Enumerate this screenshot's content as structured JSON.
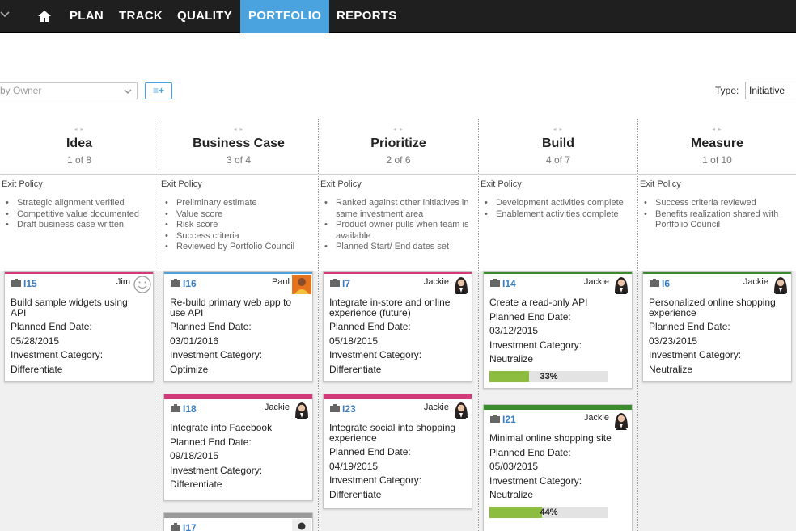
{
  "nav": {
    "items": [
      {
        "label": "PLAN"
      },
      {
        "label": "TRACK"
      },
      {
        "label": "QUALITY"
      },
      {
        "label": "PORTFOLIO",
        "active": true
      },
      {
        "label": "REPORTS"
      }
    ],
    "active_color": "#4aa3df"
  },
  "filters": {
    "owner_placeholder": "by Owner",
    "add_label": "≡+",
    "type_label": "Type:",
    "type_value": "Initiative"
  },
  "columns": [
    {
      "title": "Idea",
      "count": "1 of 8",
      "policy_title": "Exit Policy",
      "policy": [
        "Strategic alignment verified",
        "Competitive value documented",
        "Draft business case written"
      ],
      "cards": [
        {
          "id": "I15",
          "owner": "Jim",
          "name": "Build sample widgets using API",
          "date_label": "Planned End Date:",
          "date": "05/28/2015",
          "category_label": "Investment Category:",
          "category": "Differentiate",
          "color": "#d23a7a",
          "avatar": "smiley-avatar"
        }
      ]
    },
    {
      "title": "Business Case",
      "count": "3 of 4",
      "policy_title": "Exit Policy",
      "policy": [
        "Preliminary estimate",
        "Value score",
        "Risk score",
        "Success criteria",
        "Reviewed by Portfolio Council"
      ],
      "cards": [
        {
          "id": "I16",
          "owner": "Paul",
          "name": "Re-build primary web app to use API",
          "date_label": "Planned End Date:",
          "date": "03/01/2016",
          "category_label": "Investment Category:",
          "category": "Optimize",
          "color": "#4aa3df",
          "avatar": "paul-avatar"
        },
        {
          "id": "I18",
          "owner": "Jackie",
          "name": "Integrate into Facebook",
          "date_label": "Planned End Date:",
          "date": "09/18/2015",
          "category_label": "Investment Category:",
          "category": "Differentiate",
          "color": "#d23a7a",
          "avatar": "jackie-avatar"
        },
        {
          "id": "I17",
          "owner": "",
          "name": "",
          "color": "#9a9a9a",
          "avatar": "silhouette-avatar"
        }
      ]
    },
    {
      "title": "Prioritize",
      "count": "2 of 6",
      "policy_title": "Exit Policy",
      "policy": [
        "Ranked against other initiatives in same investment area",
        "Product owner pulls when team is available",
        "Planned Start/ End dates set"
      ],
      "cards": [
        {
          "id": "I7",
          "owner": "Jackie",
          "name": "Integrate in-store and online experience (future)",
          "date_label": "Planned End Date:",
          "date": "05/18/2015",
          "category_label": "Investment Category:",
          "category": "Differentiate",
          "color": "#d23a7a",
          "avatar": "jackie-avatar"
        },
        {
          "id": "I23",
          "owner": "Jackie",
          "name": "Integrate social into shopping experience",
          "date_label": "Planned End Date:",
          "date": "04/19/2015",
          "category_label": "Investment Category:",
          "category": "Differentiate",
          "color": "#d23a7a",
          "avatar": "jackie-avatar"
        }
      ]
    },
    {
      "title": "Build",
      "count": "4 of 7",
      "policy_title": "Exit Policy",
      "policy": [
        "Development activities complete",
        "Enablement activities complete"
      ],
      "cards": [
        {
          "id": "I14",
          "owner": "Jackie",
          "name": "Create a read-only API",
          "date_label": "Planned End Date:",
          "date": "03/12/2015",
          "category_label": "Investment Category:",
          "category": "Neutralize",
          "progress": 33,
          "progress_label": "33%",
          "color": "#3b8a2e",
          "avatar": "jackie-avatar"
        },
        {
          "id": "I21",
          "owner": "Jackie",
          "name": "Minimal online shopping site",
          "date_label": "Planned End Date:",
          "date": "05/03/2015",
          "category_label": "Investment Category:",
          "category": "Neutralize",
          "progress": 44,
          "progress_label": "44%",
          "color": "#3b8a2e",
          "avatar": "jackie-avatar"
        }
      ]
    },
    {
      "title": "Measure",
      "count": "1 of 10",
      "policy_title": "Exit Policy",
      "policy": [
        "Success criteria reviewed",
        "Benefits realization shared with Portfolio Council"
      ],
      "cards": [
        {
          "id": "I6",
          "owner": "Jackie",
          "name": "Personalized online shopping experience",
          "date_label": "Planned End Date:",
          "date": "03/23/2015",
          "category_label": "Investment Category:",
          "category": "Neutralize",
          "color": "#3b8a2e",
          "avatar": "jackie-avatar"
        }
      ]
    }
  ]
}
